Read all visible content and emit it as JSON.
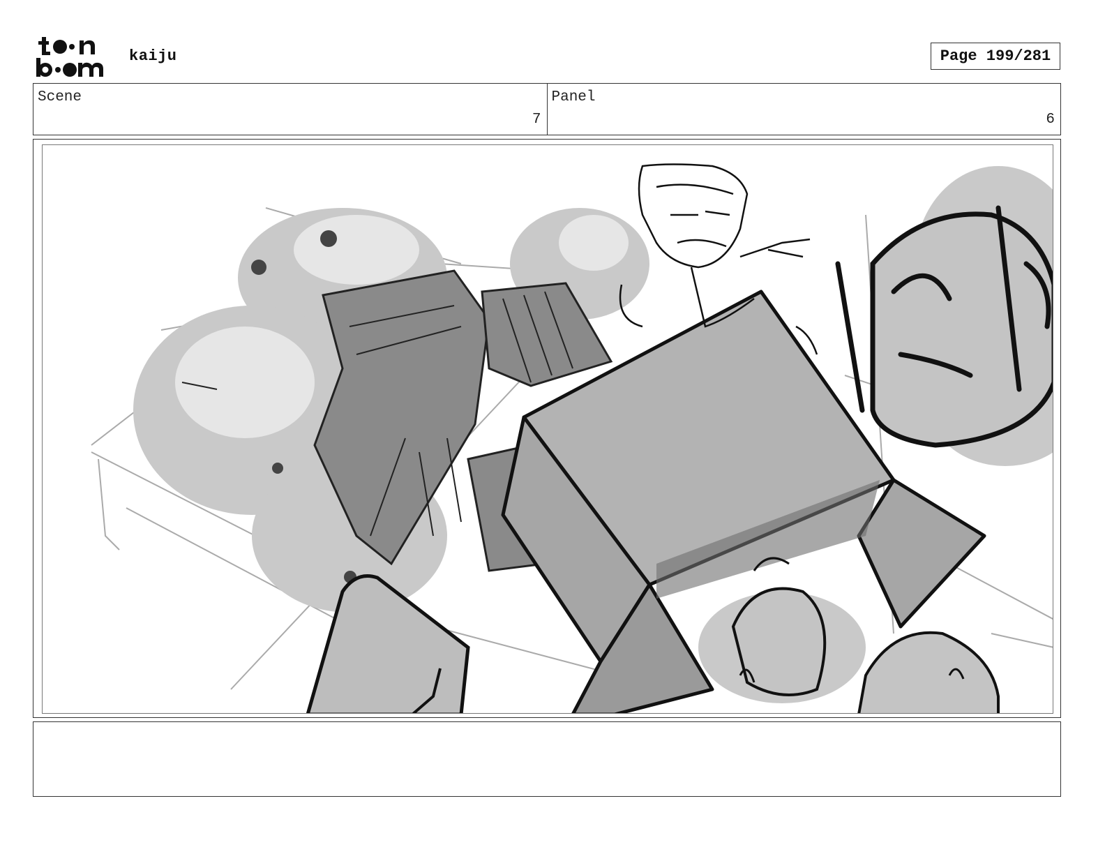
{
  "header": {
    "project_title": "kaiju",
    "page_label": "Page 199/281"
  },
  "info": {
    "scene_label": "Scene",
    "scene_value": "7",
    "panel_label": "Panel",
    "panel_value": "6"
  },
  "notes": {
    "text": ""
  },
  "logo": {
    "icon": "toon-boom-logo"
  }
}
